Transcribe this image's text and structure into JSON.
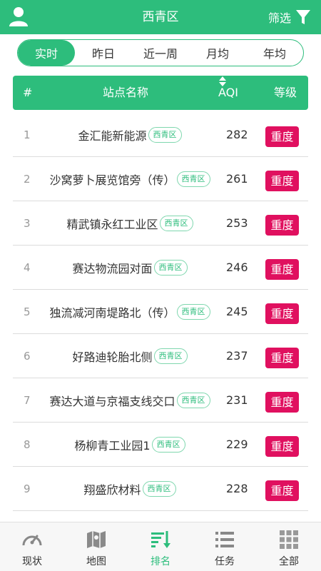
{
  "header": {
    "title": "西青区",
    "filter_label": "筛选"
  },
  "tabs": [
    {
      "label": "实时",
      "active": true
    },
    {
      "label": "昨日",
      "active": false
    },
    {
      "label": "近一周",
      "active": false
    },
    {
      "label": "月均",
      "active": false
    },
    {
      "label": "年均",
      "active": false
    }
  ],
  "table": {
    "headers": {
      "index": "#",
      "name": "站点名称",
      "aqi": "AQI",
      "grade": "等级"
    },
    "rows": [
      {
        "index": "1",
        "name": "金汇能新能源",
        "district": "西青区",
        "aqi": "282",
        "grade": "重度"
      },
      {
        "index": "2",
        "name": "沙窝萝卜展览馆旁（传）",
        "district": "西青区",
        "aqi": "261",
        "grade": "重度"
      },
      {
        "index": "3",
        "name": "精武镇永红工业区",
        "district": "西青区",
        "aqi": "253",
        "grade": "重度"
      },
      {
        "index": "4",
        "name": "赛达物流园对面",
        "district": "西青区",
        "aqi": "246",
        "grade": "重度"
      },
      {
        "index": "5",
        "name": "独流减河南堤路北（传）",
        "district": "西青区",
        "aqi": "245",
        "grade": "重度"
      },
      {
        "index": "6",
        "name": "好路迪轮胎北侧",
        "district": "西青区",
        "aqi": "237",
        "grade": "重度"
      },
      {
        "index": "7",
        "name": "赛达大道与京福支线交口",
        "district": "西青区",
        "aqi": "231",
        "grade": "重度"
      },
      {
        "index": "8",
        "name": "杨柳青工业园1",
        "district": "西青区",
        "aqi": "229",
        "grade": "重度"
      },
      {
        "index": "9",
        "name": "翔盛欣材料",
        "district": "西青区",
        "aqi": "228",
        "grade": "重度"
      }
    ]
  },
  "bottom_nav": [
    {
      "label": "现状",
      "icon": "gauge-icon",
      "active": false
    },
    {
      "label": "地图",
      "icon": "map-icon",
      "active": false
    },
    {
      "label": "排名",
      "icon": "ranking-icon",
      "active": true
    },
    {
      "label": "任务",
      "icon": "task-list-icon",
      "active": false
    },
    {
      "label": "全部",
      "icon": "grid-icon",
      "active": false
    }
  ],
  "colors": {
    "primary": "#2dbd7c",
    "severe": "#e0105f"
  }
}
